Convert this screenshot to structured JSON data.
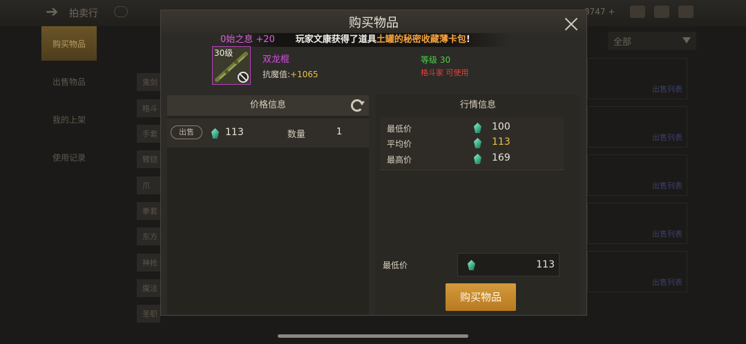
{
  "background": {
    "title": "拍卖行",
    "currency_partial": "8747 +",
    "nav": [
      "购买物品",
      "出售物品",
      "我的上架",
      "使用记录"
    ],
    "categories": [
      "鬼剑",
      "格斗",
      "手套",
      "臂铠",
      "爪",
      "拳套",
      "东方",
      "神枪",
      "魔法",
      "圣职"
    ],
    "filter_label": "全部",
    "row_link": "出售列表"
  },
  "modal": {
    "title": "购买物品",
    "ticker": {
      "prefix": "0始之息 +20",
      "player_text": "玩家文康获得了道具",
      "item_text": "土罐的秘密收藏薄卡包",
      "suffix": "!"
    },
    "item": {
      "level_badge": "30级",
      "name": "双龙棍",
      "stat_label": "抗魔值:",
      "stat_value": "+1065",
      "level_req": "等级 30",
      "class_req": "格斗家 可使用"
    },
    "price_panel": {
      "header": "价格信息",
      "listing": {
        "badge": "出售",
        "price": "113",
        "qty_label": "数量",
        "qty": "1"
      }
    },
    "market_panel": {
      "header": "行情信息",
      "rows": [
        {
          "label": "最低价",
          "value": "100"
        },
        {
          "label": "平均价",
          "value": "113"
        },
        {
          "label": "最高价",
          "value": "169"
        }
      ],
      "min_label": "最低价",
      "min_value": "113",
      "buy_label": "购买物品"
    }
  },
  "colors": {
    "accent_gold": "#d49a3a",
    "rarity_purple": "#d24ee0",
    "level_green": "#44d544",
    "class_red": "#e24040"
  }
}
